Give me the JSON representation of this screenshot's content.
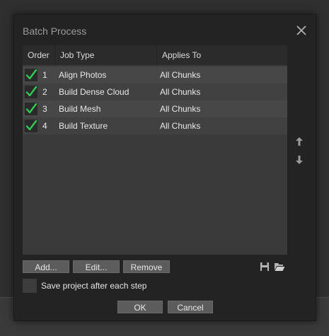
{
  "dialog": {
    "title": "Batch Process",
    "columns": {
      "order": "Order",
      "job_type": "Job Type",
      "applies_to": "Applies To"
    },
    "rows": [
      {
        "order": "1",
        "job_type": "Align Photos",
        "applies_to": "All Chunks",
        "checked": true
      },
      {
        "order": "2",
        "job_type": "Build Dense Cloud",
        "applies_to": "All Chunks",
        "checked": true
      },
      {
        "order": "3",
        "job_type": "Build Mesh",
        "applies_to": "All Chunks",
        "checked": true
      },
      {
        "order": "4",
        "job_type": "Build Texture",
        "applies_to": "All Chunks",
        "checked": true
      }
    ],
    "buttons": {
      "add": "Add...",
      "edit": "Edit...",
      "remove": "Remove",
      "ok": "OK",
      "cancel": "Cancel"
    },
    "save_option": {
      "label": "Save project after each step",
      "checked": false
    },
    "icons": {
      "close": "close-icon",
      "move_up": "arrow-up-icon",
      "move_down": "arrow-down-icon",
      "save": "save-icon",
      "open": "folder-open-icon",
      "check": "checkmark-icon"
    },
    "colors": {
      "check": "#2ecc55",
      "dialog_bg": "#232323",
      "table_bg": "#3a3a3a",
      "button_bg": "#5c5c5c"
    }
  }
}
